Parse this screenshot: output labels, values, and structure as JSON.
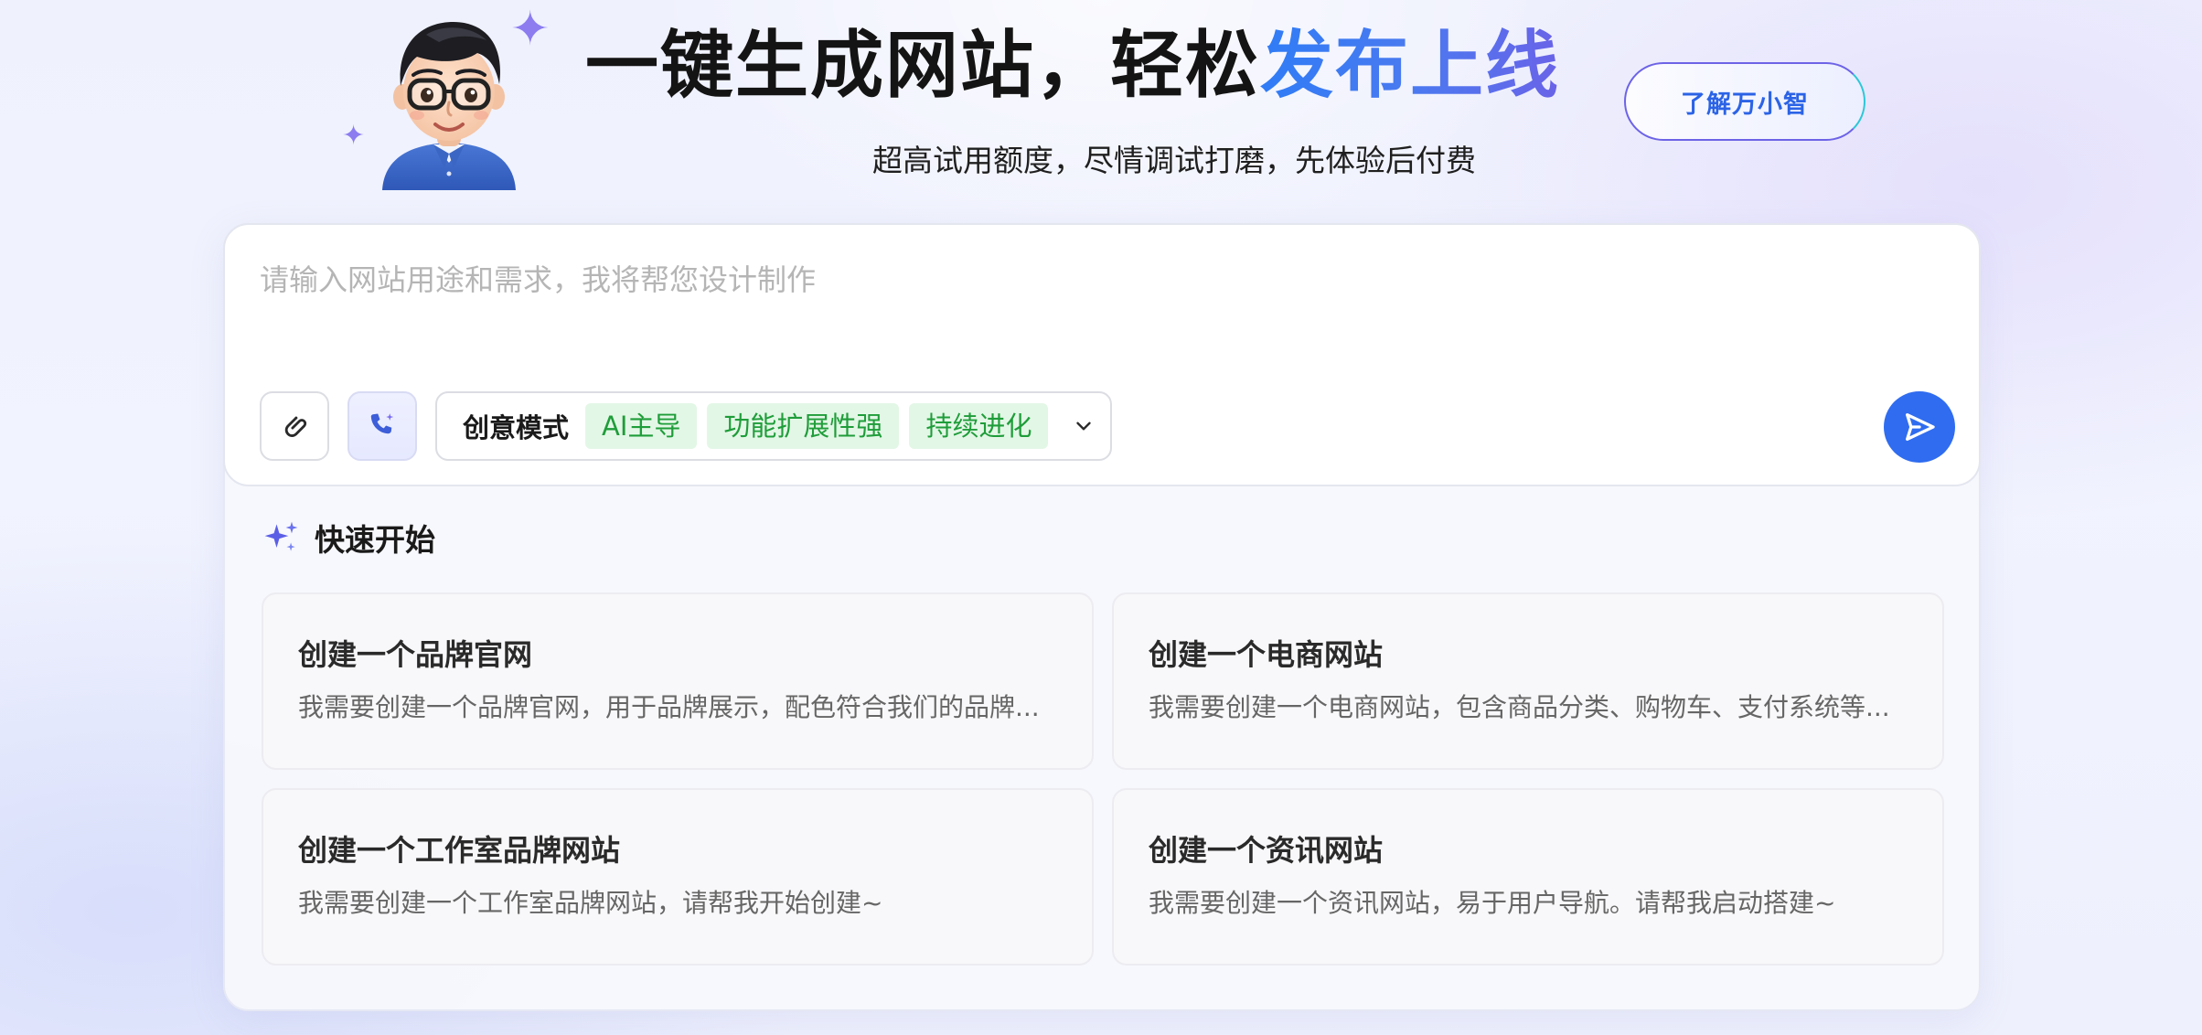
{
  "hero": {
    "title_main": "一键生成网站，轻松",
    "title_accent": "发布上线",
    "subtitle": "超高试用额度，尽情调试打磨，先体验后付费",
    "learn_button": "了解万小智"
  },
  "input": {
    "placeholder": "请输入网站用途和需求，我将帮您设计制作",
    "value": ""
  },
  "toolbar": {
    "mode_label": "创意模式",
    "chips": [
      "AI主导",
      "功能扩展性强",
      "持续进化"
    ]
  },
  "quick_start": {
    "title": "快速开始",
    "cards": [
      {
        "title": "创建一个品牌官网",
        "desc": "我需要创建一个品牌官网，用于品牌展示，配色符合我们的品牌..."
      },
      {
        "title": "创建一个电商网站",
        "desc": "我需要创建一个电商网站，包含商品分类、购物车、支付系统等..."
      },
      {
        "title": "创建一个工作室品牌网站",
        "desc": "我需要创建一个工作室品牌网站，请帮我开始创建~"
      },
      {
        "title": "创建一个资讯网站",
        "desc": "我需要创建一个资讯网站，易于用户导航。请帮我启动搭建~"
      }
    ]
  },
  "icons": {
    "attach": "paperclip-icon",
    "voice": "phone-sparkle-icon",
    "chevron": "chevron-down-icon",
    "send": "send-icon",
    "quick_start": "sparkles-icon"
  },
  "colors": {
    "accent": "#2f6cf0",
    "title_gradient_start": "#2f7cf6",
    "title_gradient_end": "#6a63e8",
    "chip_bg": "#e3f7e6",
    "chip_text": "#1f9d3a"
  }
}
